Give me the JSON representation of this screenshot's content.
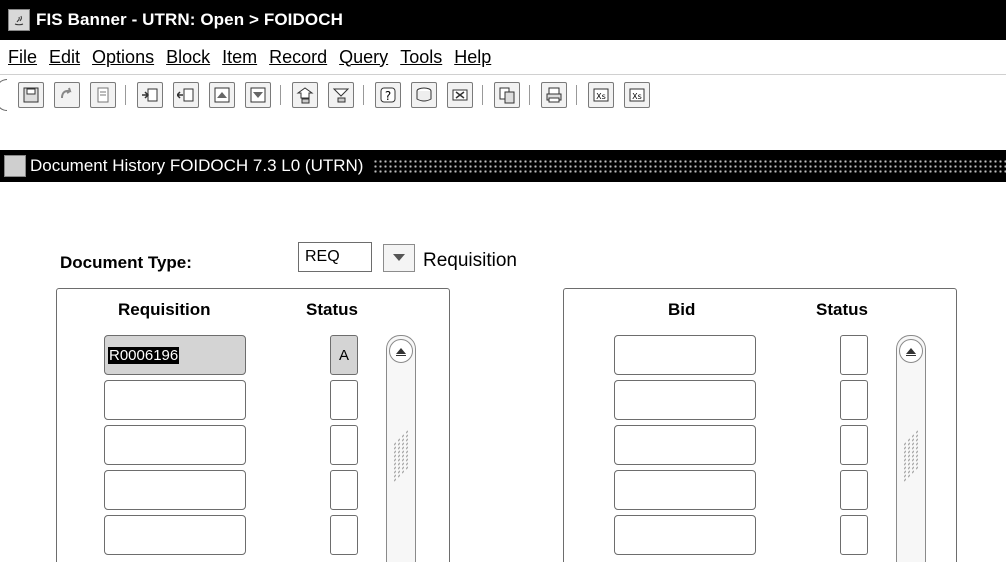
{
  "window": {
    "title": "FIS Banner - UTRN:  Open > FOIDOCH"
  },
  "menu": {
    "items": [
      "File",
      "Edit",
      "Options",
      "Block",
      "Item",
      "Record",
      "Query",
      "Tools",
      "Help"
    ]
  },
  "toolbar": {
    "icons": [
      "save-icon",
      "rollback-icon",
      "print-form-icon",
      "insert-record-icon",
      "remove-record-icon",
      "clear-record-icon",
      "clear-form-icon",
      "next-block-icon",
      "previous-block-icon",
      "help-icon",
      "calendar-icon",
      "exit-icon",
      "copy-icon",
      "print-icon",
      "calculator-icon",
      "other-icon"
    ]
  },
  "form": {
    "title": "Document History  FOIDOCH  7.3 L0  (UTRN)"
  },
  "doctype": {
    "label": "Document Type:",
    "value": "REQ",
    "description": "Requisition"
  },
  "left_panel": {
    "col1_header": "Requisition",
    "col2_header": "Status",
    "rows": [
      {
        "number": "R0006196",
        "status": "A"
      },
      {
        "number": "",
        "status": ""
      },
      {
        "number": "",
        "status": ""
      },
      {
        "number": "",
        "status": ""
      },
      {
        "number": "",
        "status": ""
      }
    ]
  },
  "right_panel": {
    "col1_header": "Bid",
    "col2_header": "Status",
    "rows": [
      {
        "number": "",
        "status": ""
      },
      {
        "number": "",
        "status": ""
      },
      {
        "number": "",
        "status": ""
      },
      {
        "number": "",
        "status": ""
      },
      {
        "number": "",
        "status": ""
      }
    ]
  }
}
